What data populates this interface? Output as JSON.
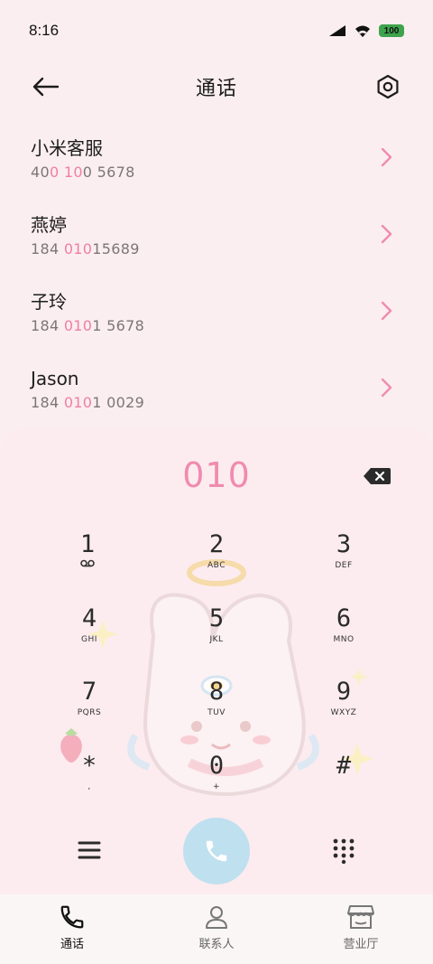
{
  "status_bar": {
    "time": "8:16",
    "battery": "100"
  },
  "header": {
    "title": "通话"
  },
  "contacts": [
    {
      "name": "小米客服",
      "number_parts": [
        "40",
        "0 10",
        "0 5678"
      ]
    },
    {
      "name": "燕婷",
      "number_parts": [
        "184 ",
        "010",
        "15689"
      ]
    },
    {
      "name": "子玲",
      "number_parts": [
        "184 ",
        "010",
        "1 5678"
      ]
    },
    {
      "name": "Jason",
      "number_parts": [
        "184 ",
        "010",
        "1 0029"
      ]
    }
  ],
  "dialer": {
    "input": "010",
    "keys": [
      {
        "digit": "1",
        "letters": ""
      },
      {
        "digit": "2",
        "letters": "ABC"
      },
      {
        "digit": "3",
        "letters": "DEF"
      },
      {
        "digit": "4",
        "letters": "GHI"
      },
      {
        "digit": "5",
        "letters": "JKL"
      },
      {
        "digit": "6",
        "letters": "MNO"
      },
      {
        "digit": "7",
        "letters": "PQRS"
      },
      {
        "digit": "8",
        "letters": "TUV"
      },
      {
        "digit": "9",
        "letters": "WXYZ"
      },
      {
        "digit": "*",
        "letters": ","
      },
      {
        "digit": "0",
        "letters": "+"
      },
      {
        "digit": "#",
        "letters": ""
      }
    ]
  },
  "bottom_nav": [
    {
      "label": "通话",
      "icon": "phone-icon",
      "active": true
    },
    {
      "label": "联系人",
      "icon": "person-icon",
      "active": false
    },
    {
      "label": "营业厅",
      "icon": "store-icon",
      "active": false
    }
  ],
  "colors": {
    "accent": "#f08bb0",
    "call_button": "#bfe0ef",
    "background": "#fbeef0"
  }
}
